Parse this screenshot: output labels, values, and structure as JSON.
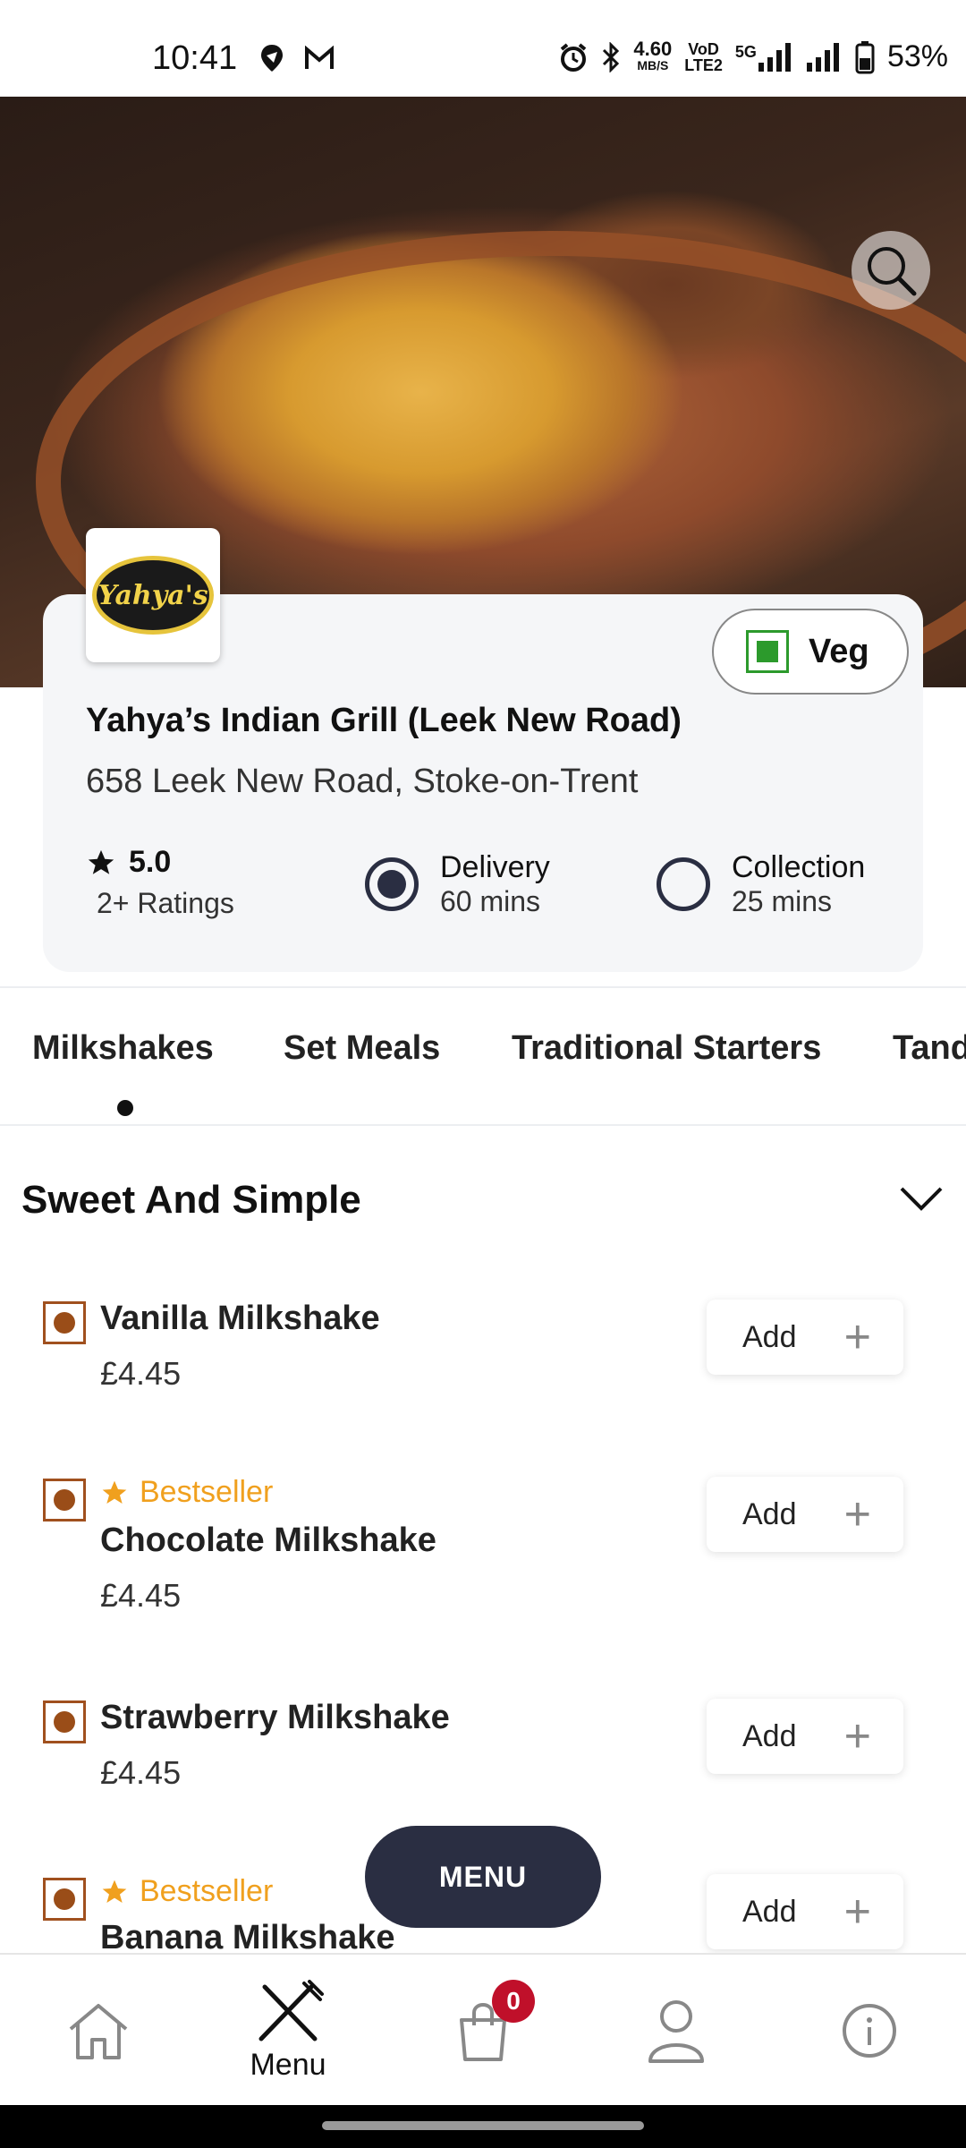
{
  "status_bar": {
    "time": "10:41",
    "speed_value": "4.60",
    "speed_unit": "MB/S",
    "volte_top": "VoD",
    "volte_bottom": "LTE2",
    "network": "5G",
    "battery": "53%"
  },
  "hero": {
    "search_icon": "search-icon"
  },
  "restaurant": {
    "logo_text": "Yahya's",
    "name": "Yahya’s Indian Grill (Leek New Road)",
    "address": "658 Leek New Road, Stoke-on-Trent",
    "rating": "5.0",
    "ratings_count": "2+ Ratings",
    "veg_filter_label": "Veg",
    "delivery": {
      "label": "Delivery",
      "time": "60 mins",
      "selected": true
    },
    "collection": {
      "label": "Collection",
      "time": "25 mins",
      "selected": false
    }
  },
  "tabs": [
    {
      "label": "Milkshakes",
      "active": true
    },
    {
      "label": "Set Meals",
      "active": false
    },
    {
      "label": "Traditional Starters",
      "active": false
    },
    {
      "label": "Tandoori",
      "active": false
    }
  ],
  "section": {
    "title": "Sweet And Simple"
  },
  "items": [
    {
      "name": "Vanilla Milkshake",
      "price": "£4.45",
      "bestseller": false,
      "add_label": "Add"
    },
    {
      "name": "Chocolate Milkshake",
      "price": "£4.45",
      "bestseller": true,
      "bestseller_label": "Bestseller",
      "add_label": "Add"
    },
    {
      "name": "Strawberry Milkshake",
      "price": "£4.45",
      "bestseller": false,
      "add_label": "Add"
    },
    {
      "name": "Banana Milkshake",
      "price": "",
      "bestseller": true,
      "bestseller_label": "Bestseller",
      "add_label": "Add"
    }
  ],
  "menu_button": "MENU",
  "bottom_nav": {
    "menu_label": "Menu",
    "cart_count": "0"
  },
  "colors": {
    "dark_navy": "#2a2e42",
    "veg_green": "#2c9a2c",
    "nonveg_brown": "#9a4d18",
    "bestseller_orange": "#f0a01e",
    "badge_red": "#c0102a"
  }
}
